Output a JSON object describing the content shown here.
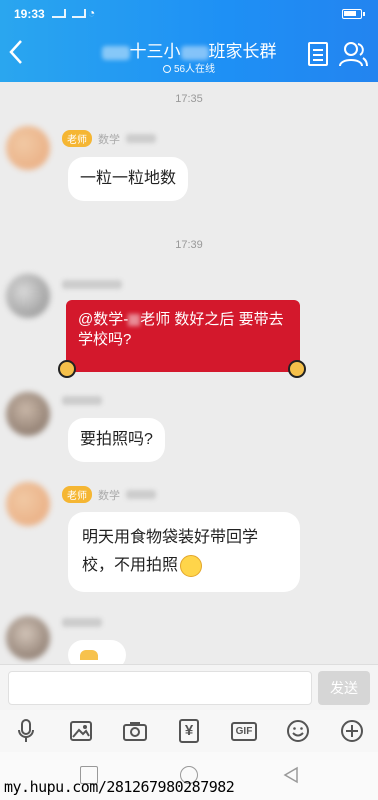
{
  "status": {
    "time": "19:33"
  },
  "header": {
    "title_pre": "十三小",
    "title_post": "班家长群",
    "online": "56人在线",
    "back_icon": "back-chevron-icon",
    "doc_icon": "document-icon",
    "people_icon": "group-members-icon"
  },
  "messages": [
    {
      "time": "17:35"
    },
    {
      "badge": "老师",
      "sender": "数学",
      "text": "一粒一粒地数"
    },
    {
      "time": "17:39"
    },
    {
      "card_pre": "@数学-",
      "card_post": "老师 数好之后 要带去学校吗?"
    },
    {
      "text": "要拍照吗?"
    },
    {
      "badge": "老师",
      "sender": "数学",
      "text_line1": "明天用食物袋装好带回学",
      "text_line2": "校，不用拍照"
    }
  ],
  "input": {
    "send_label": "发送"
  },
  "toolbar": {
    "gif_label": "GIF",
    "yen_label": "¥"
  },
  "watermark": "my.hupu.com/28126798028798​2"
}
